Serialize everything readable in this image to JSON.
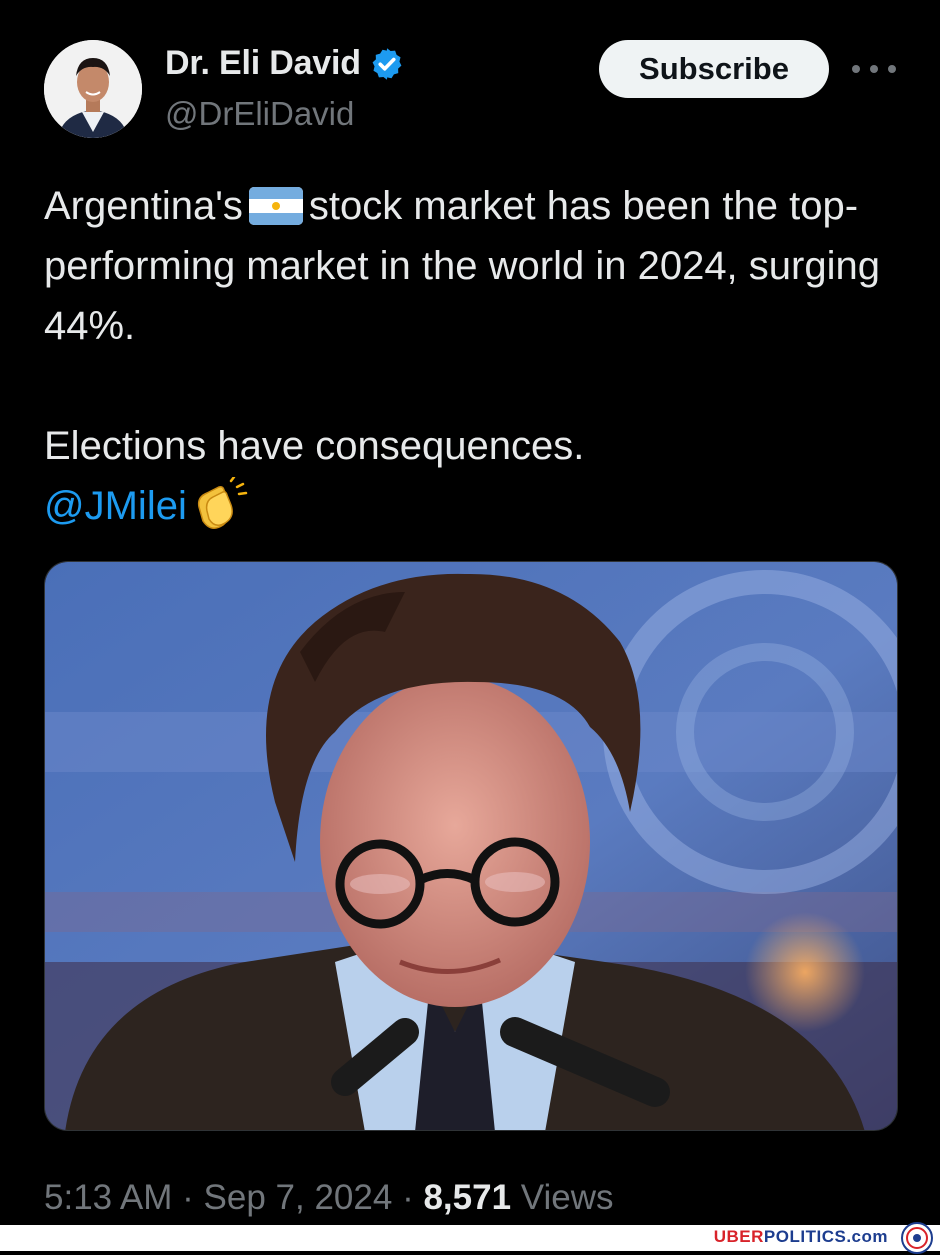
{
  "author": {
    "name": "Dr. Eli David",
    "handle": "@DrEliDavid",
    "verified": true,
    "verified_color": "#1d9bf0"
  },
  "actions": {
    "subscribe_label": "Subscribe",
    "more_icon": "more-horizontal-icon"
  },
  "tweet": {
    "line1_before_flag": "Argentina's",
    "flag_emoji": "argentina-flag",
    "line1_after_flag": "stock market has been the top-performing market in the world in 2024, surging 44%.",
    "line2": "Elections have consequences.",
    "mention": "@JMilei",
    "mention_emoji": "clapping-hands",
    "mention_color": "#1d9bf0"
  },
  "media": {
    "description_icon": "photo-man-with-glasses-at-microphones"
  },
  "meta": {
    "time": "5:13 AM",
    "date": "Sep 7, 2024",
    "views_count": "8,571",
    "views_label": "Views"
  },
  "watermark": {
    "part1": "UBER",
    "part2": "POLITICS.com",
    "part1_color": "#d8232a",
    "part2_color": "#1d3d8f"
  }
}
